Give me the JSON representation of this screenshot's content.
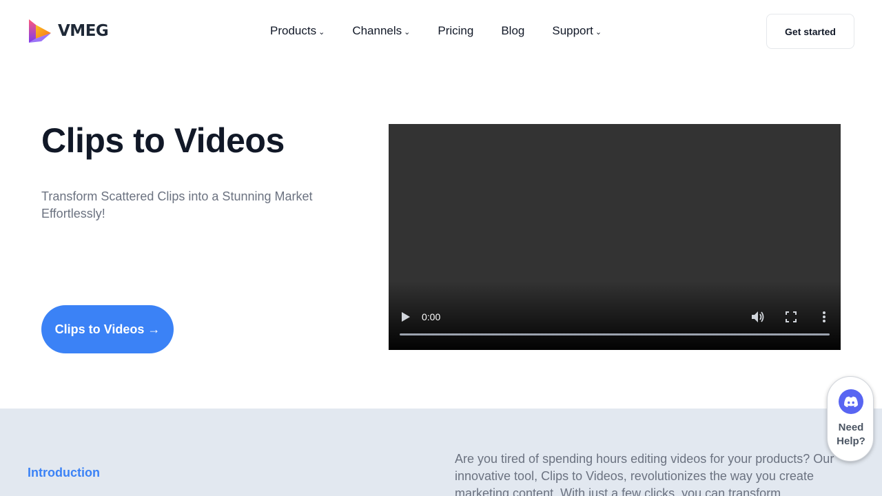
{
  "brand": {
    "name": "VMEG"
  },
  "nav": {
    "items": [
      {
        "label": "Products",
        "has_dropdown": true
      },
      {
        "label": "Channels",
        "has_dropdown": true
      },
      {
        "label": "Pricing",
        "has_dropdown": false
      },
      {
        "label": "Blog",
        "has_dropdown": false
      },
      {
        "label": "Support",
        "has_dropdown": true
      }
    ],
    "chevron": "⌄",
    "cta_label": "Get started"
  },
  "hero": {
    "title": "Clips to Videos",
    "subtitle": "Transform Scattered Clips into a Stunning Market Effortlessly!",
    "button_label": "Clips to Videos →"
  },
  "video": {
    "time": "0:00",
    "controls": [
      "play-icon",
      "volume-icon",
      "fullscreen-icon",
      "more-options-icon"
    ]
  },
  "intro": {
    "label": "Introduction",
    "text": "Are you tired of spending hours editing videos for your products? Our innovative tool, Clips to Videos, revolutionizes the way you create marketing content. With just a few clicks, you can transform"
  },
  "help_widget": {
    "line1": "Need",
    "line2": "Help?",
    "icon": "discord-icon"
  },
  "colors": {
    "accent": "#3b82f6",
    "section_bg": "#e2e8f0",
    "discord": "#5865f2"
  }
}
